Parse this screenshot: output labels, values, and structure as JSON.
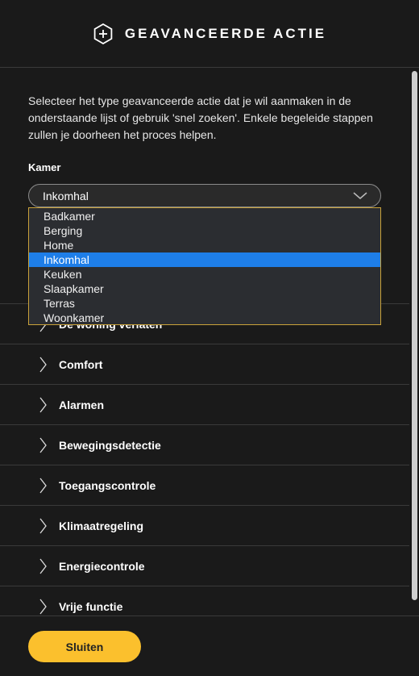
{
  "header": {
    "title": "GEAVANCEERDE ACTIE",
    "icon": "hexagon-plus-icon"
  },
  "intro": "Selecteer het type geavanceerde actie dat je wil aanmaken in de onderstaande lijst of gebruik 'snel zoeken'. Enkele begeleide stappen zullen je doorheen het proces helpen.",
  "room_field": {
    "label": "Kamer",
    "selected": "Inkomhal",
    "options": [
      "Badkamer",
      "Berging",
      "Home",
      "Inkomhal",
      "Keuken",
      "Slaapkamer",
      "Terras",
      "Woonkamer"
    ]
  },
  "categories": [
    "De woning verlaten",
    "Comfort",
    "Alarmen",
    "Bewegingsdetectie",
    "Toegangscontrole",
    "Klimaatregeling",
    "Energiecontrole",
    "Vrije functie"
  ],
  "footer": {
    "close_label": "Sluiten"
  },
  "colors": {
    "accent": "#fbc02d",
    "selection": "#1e7ee8",
    "dropdown_border": "#c9a23a"
  }
}
